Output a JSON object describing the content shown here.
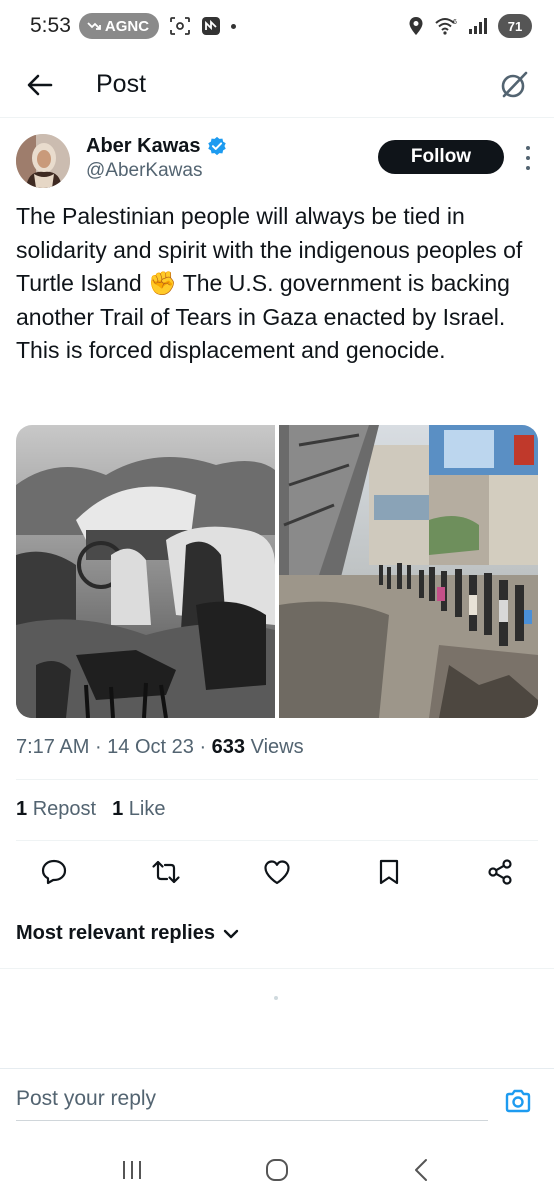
{
  "status_bar": {
    "time": "5:53",
    "pill_label": "AGNC",
    "battery": "71"
  },
  "header": {
    "title": "Post",
    "back_icon": "arrow-left-icon",
    "grok_icon": "grok-icon"
  },
  "author": {
    "name": "Aber Kawas",
    "handle": "@AberKawas",
    "verified": true,
    "follow_label": "Follow"
  },
  "tweet": {
    "text": "The Palestinian people will always be tied in solidarity and spirit with the indigenous peoples of Turtle Island ✊ The U.S. government is backing another Trail of Tears in Gaza enacted by Israel. This is forced displacement and genocide."
  },
  "meta": {
    "time": "7:17 AM",
    "date": "14 Oct 23",
    "views_count": "633",
    "views_label": "Views"
  },
  "stats": {
    "reposts_count": "1",
    "reposts_label": "Repost",
    "likes_count": "1",
    "likes_label": "Like"
  },
  "actions": [
    "reply-icon",
    "repost-icon",
    "like-icon",
    "bookmark-icon",
    "share-icon"
  ],
  "replies": {
    "sort_label": "Most relevant replies"
  },
  "reply_bar": {
    "placeholder": "Post your reply"
  },
  "colors": {
    "accent": "#1d9bf0",
    "text_primary": "#0f1419",
    "text_secondary": "#536471"
  }
}
